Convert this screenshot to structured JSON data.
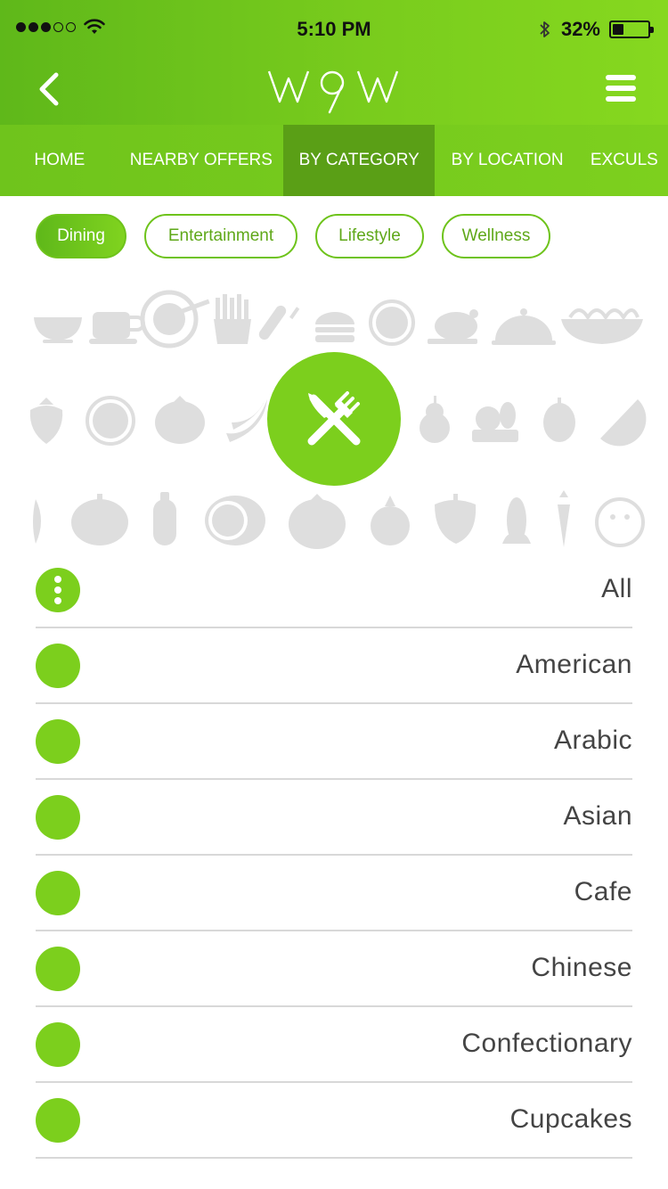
{
  "status": {
    "signal_dots_filled": 3,
    "signal_dots_total": 5,
    "time": "5:10 PM",
    "battery": "32%",
    "battery_level": 0.32
  },
  "nav": {
    "logo_text": "W9W"
  },
  "tabs": [
    {
      "label": "HOME",
      "active": false
    },
    {
      "label": "NEARBY OFFERS",
      "active": false
    },
    {
      "label": "BY CATEGORY",
      "active": true
    },
    {
      "label": "BY LOCATION",
      "active": false
    },
    {
      "label": "EXCULS",
      "active": false
    }
  ],
  "chips": [
    {
      "label": "Dining",
      "active": true
    },
    {
      "label": "Entertainment",
      "active": false
    },
    {
      "label": "Lifestyle",
      "active": false
    },
    {
      "label": "Wellness",
      "active": false
    }
  ],
  "categories": [
    "All",
    "American",
    "Arabic",
    "Asian",
    "Cafe",
    "Chinese",
    "Confectionary",
    "Cupcakes"
  ],
  "colors": {
    "accent": "#7ccf1d",
    "active_tab": "#5a9f16",
    "pattern_grey": "#dcdcdc"
  },
  "icons": {
    "back": "chevron-left-icon",
    "menu": "hamburger-menu-icon",
    "dining": "fork-knife-icon"
  }
}
